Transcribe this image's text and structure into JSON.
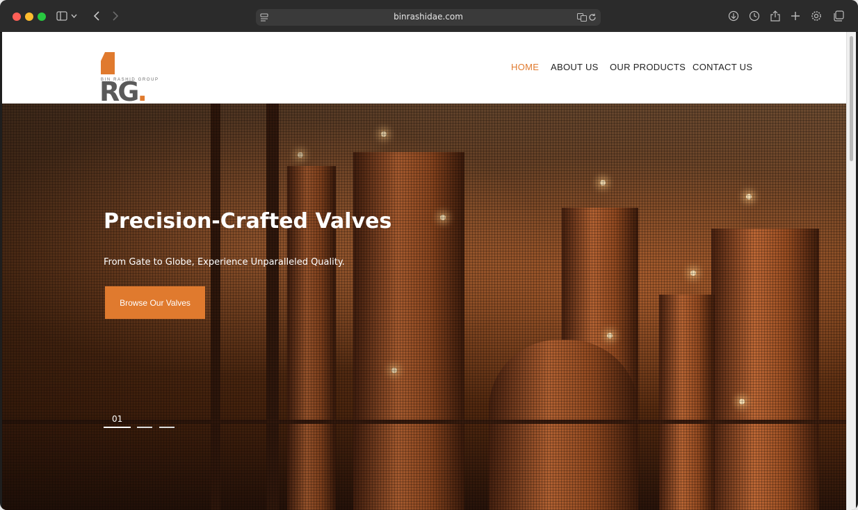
{
  "browser": {
    "url": "binrashidae.com",
    "icons": [
      "sidebar-icon",
      "chevron-down-icon",
      "back-icon",
      "forward-icon",
      "page-menu-icon",
      "translate-icon",
      "reload-icon",
      "download-icon",
      "history-icon",
      "share-icon",
      "new-tab-icon",
      "settings-icon",
      "tabs-overview-icon"
    ]
  },
  "site": {
    "logo": {
      "mark": "RG",
      "dot": ".",
      "tagline": "BIN RASHID GROUP"
    },
    "nav": {
      "home": "HOME",
      "about": "ABOUT US",
      "products": "OUR PRODUCTS",
      "contact": "CONTACT US"
    },
    "hero": {
      "title": "Precision-Crafted Valves",
      "subtitle": "From Gate to Globe, Experience Unparalleled Quality.",
      "cta": "Browse Our Valves",
      "slide_number": "01"
    }
  },
  "colors": {
    "accent": "#e07a2e",
    "nav_text": "#222222",
    "hero_text": "#ffffff"
  }
}
